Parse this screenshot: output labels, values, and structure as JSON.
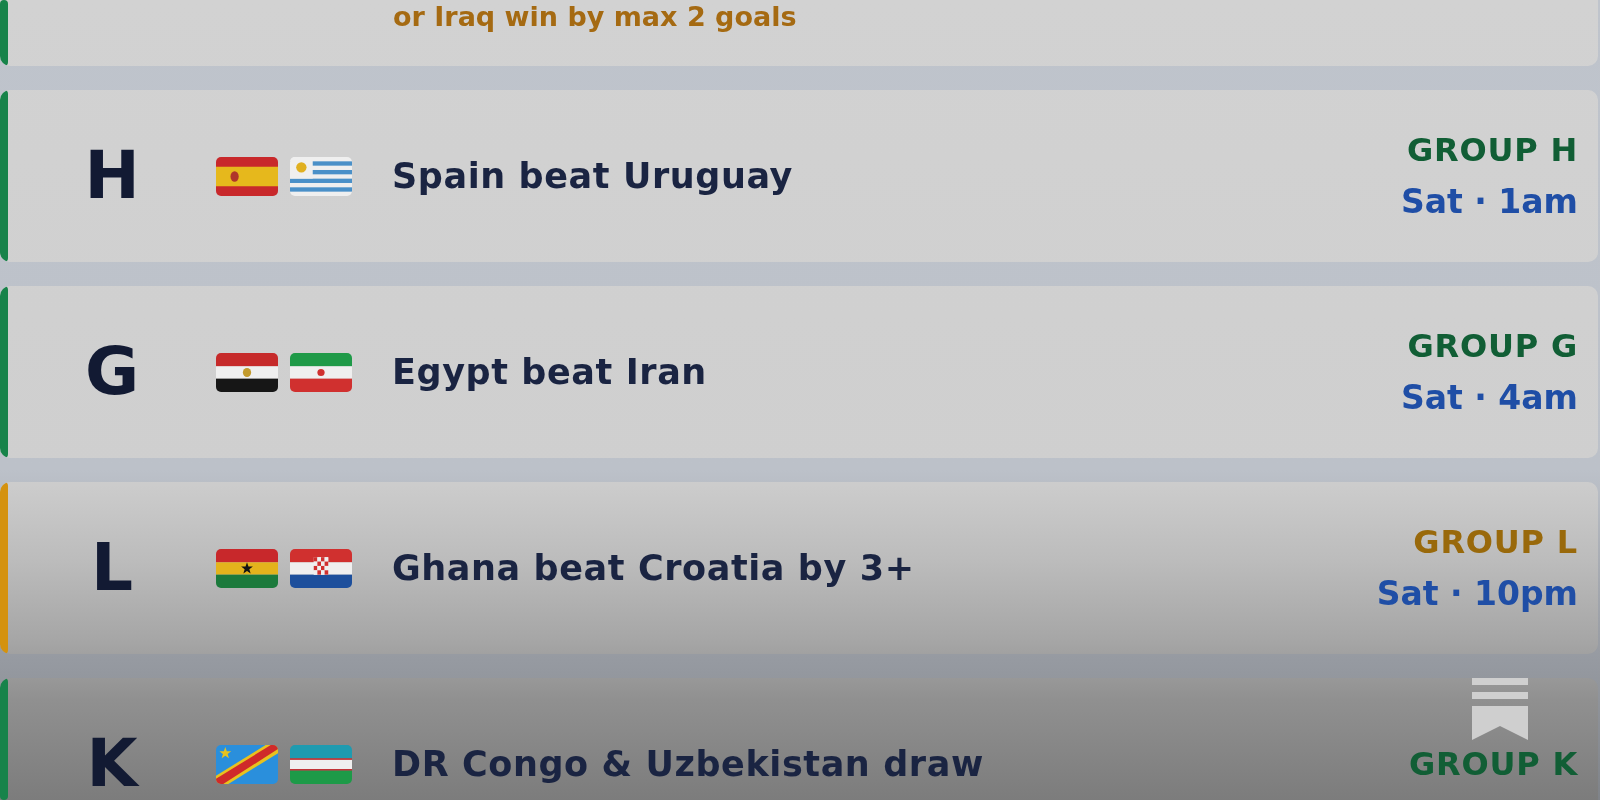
{
  "previous_card": {
    "color": "#17834a",
    "subtitle": "or Iraq win by max 2 goals"
  },
  "matches": [
    {
      "group": "H",
      "color": "#17834a",
      "flags": [
        {
          "kind": "spain"
        },
        {
          "kind": "uruguay"
        }
      ],
      "title": "Spain beat Uruguay",
      "group_label": "GROUP H",
      "time": "Sat · 1am"
    },
    {
      "group": "G",
      "color": "#17834a",
      "flags": [
        {
          "kind": "egypt"
        },
        {
          "kind": "iran"
        }
      ],
      "title": "Egypt beat Iran",
      "group_label": "GROUP G",
      "time": "Sat · 4am"
    },
    {
      "group": "L",
      "color": "#d4920f",
      "flags": [
        {
          "kind": "ghana"
        },
        {
          "kind": "croatia"
        }
      ],
      "title": "Ghana beat Croatia by 3+",
      "group_label": "GROUP L",
      "time": "Sat · 10pm"
    },
    {
      "group": "K",
      "color": "#17834a",
      "flags": [
        {
          "kind": "drcongo"
        },
        {
          "kind": "uzbekistan"
        }
      ],
      "title": "DR Congo & Uzbekistan draw",
      "group_label": "GROUP K"
    }
  ]
}
